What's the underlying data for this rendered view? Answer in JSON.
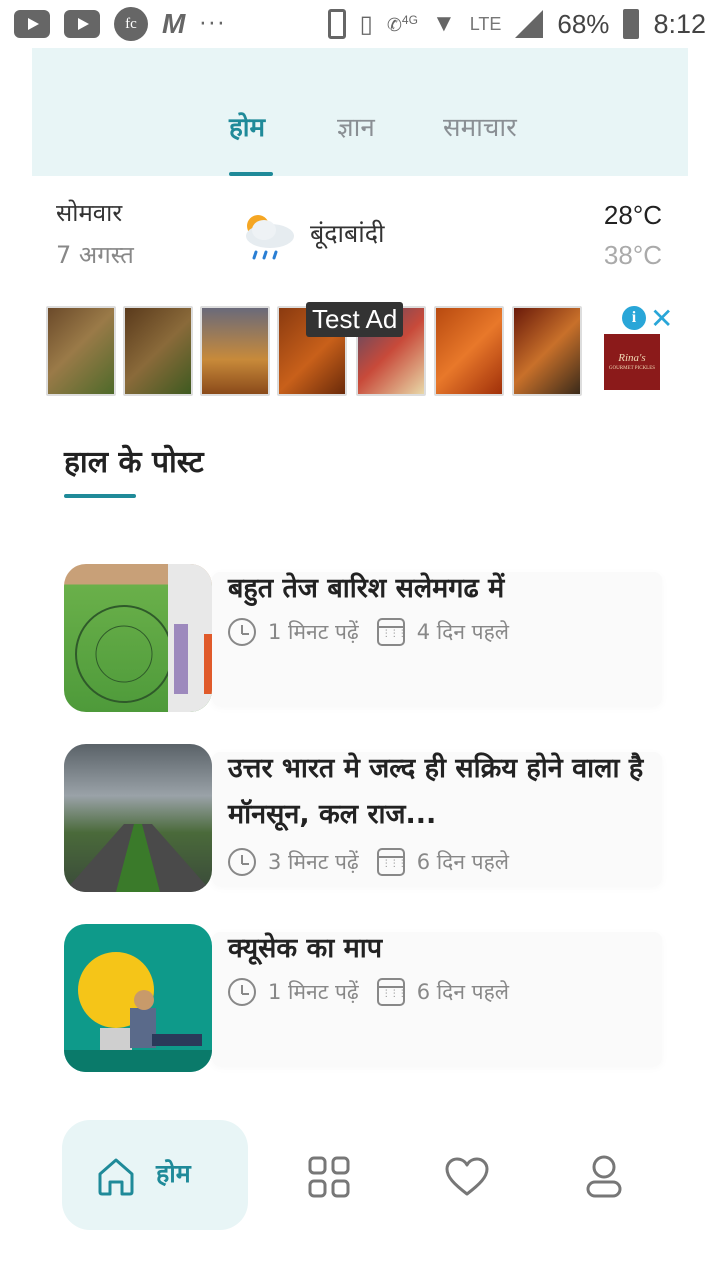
{
  "status_bar": {
    "battery": "68%",
    "time": "8:12",
    "network": "LTE",
    "network_small": "4G"
  },
  "top_tabs": [
    {
      "label": "होम",
      "active": true
    },
    {
      "label": "ज्ञान",
      "active": false
    },
    {
      "label": "समाचार",
      "active": false
    }
  ],
  "weather": {
    "day": "सोमवार",
    "date": "7 अगस्त",
    "condition": "बूंदाबांदी",
    "temp_max": "28°C",
    "temp_min": "38°C",
    "icon": "cloud-rain-sun-icon"
  },
  "ad": {
    "label": "Test Ad",
    "brand": "Rina's",
    "brand_sub": "GOURMET PICKLES"
  },
  "section": {
    "title": "हाल के पोस्ट"
  },
  "posts": [
    {
      "title": "बहुत तेज बारिश  सलेमगढ में",
      "read_time": "1 मिनट पढ़ें",
      "posted": "4 दिन पहले"
    },
    {
      "title": "उत्तर भारत मे जल्द ही सक्रिय होने वाला है मॉनसून, कल राज...",
      "read_time": "3 मिनट पढ़ें",
      "posted": "6 दिन पहले"
    },
    {
      "title": "क्यूसेक का माप",
      "read_time": "1 मिनट पढ़ें",
      "posted": "6 दिन पहले"
    }
  ],
  "bottom_nav": {
    "home_label": "होम"
  },
  "colors": {
    "accent": "#1f8a99",
    "tab_bg": "#e8f5f6"
  }
}
